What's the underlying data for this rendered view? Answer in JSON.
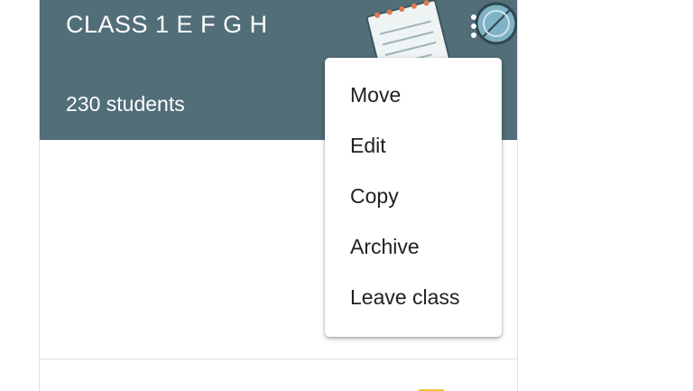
{
  "class_card": {
    "title": "CLASS 1 E F G H",
    "students": "230 students"
  },
  "context_menu": {
    "items": [
      {
        "label": "Move"
      },
      {
        "label": "Edit"
      },
      {
        "label": "Copy"
      },
      {
        "label": "Archive"
      },
      {
        "label": "Leave class"
      }
    ]
  },
  "icons": {
    "more": "more-vert-icon",
    "illustration": "notebook-illustration"
  },
  "colors": {
    "header_bg": "#526e78",
    "header_text": "#ffffff",
    "menu_text": "#202124",
    "accent": "#f4c430"
  }
}
